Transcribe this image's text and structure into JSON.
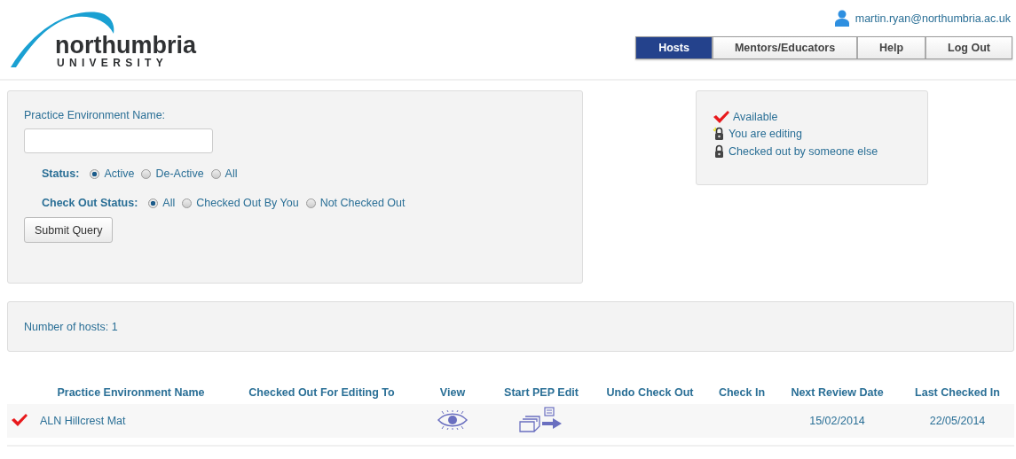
{
  "logo": {
    "name": "northumbria",
    "subtitle": "UNIVERSITY"
  },
  "user": {
    "email": "martin.ryan@northumbria.ac.uk"
  },
  "nav": [
    {
      "label": "Hosts",
      "selected": true
    },
    {
      "label": "Mentors/Educators",
      "selected": false
    },
    {
      "label": "Help",
      "selected": false
    },
    {
      "label": "Log Out",
      "selected": false
    }
  ],
  "filter": {
    "name_label": "Practice Environment Name:",
    "status": {
      "label": "Status:",
      "options": [
        {
          "label": "Active",
          "selected": true
        },
        {
          "label": "De-Active",
          "selected": false
        },
        {
          "label": "All",
          "selected": false
        }
      ]
    },
    "checkout_status": {
      "label": "Check Out Status:",
      "options": [
        {
          "label": "All",
          "selected": true
        },
        {
          "label": "Checked Out By You",
          "selected": false
        },
        {
          "label": "Not Checked Out",
          "selected": false
        }
      ]
    },
    "submit": "Submit Query"
  },
  "legend": [
    {
      "kind": "available",
      "label": "Available"
    },
    {
      "kind": "editing",
      "label": "You are editing"
    },
    {
      "kind": "locked",
      "label": "Checked out by someone else"
    }
  ],
  "host_count": "Number of hosts: 1",
  "table": {
    "columns": [
      "Practice Environment Name",
      "Checked Out For Editing To",
      "View",
      "Start PEP Edit",
      "Undo Check Out",
      "Check In",
      "Next Review Date",
      "Last Checked In"
    ],
    "rows": [
      {
        "kind": "available",
        "name": "ALN Hillcrest Mat",
        "next_review_date": "15/02/2014",
        "last_checked_in": "22/05/2014"
      }
    ]
  }
}
